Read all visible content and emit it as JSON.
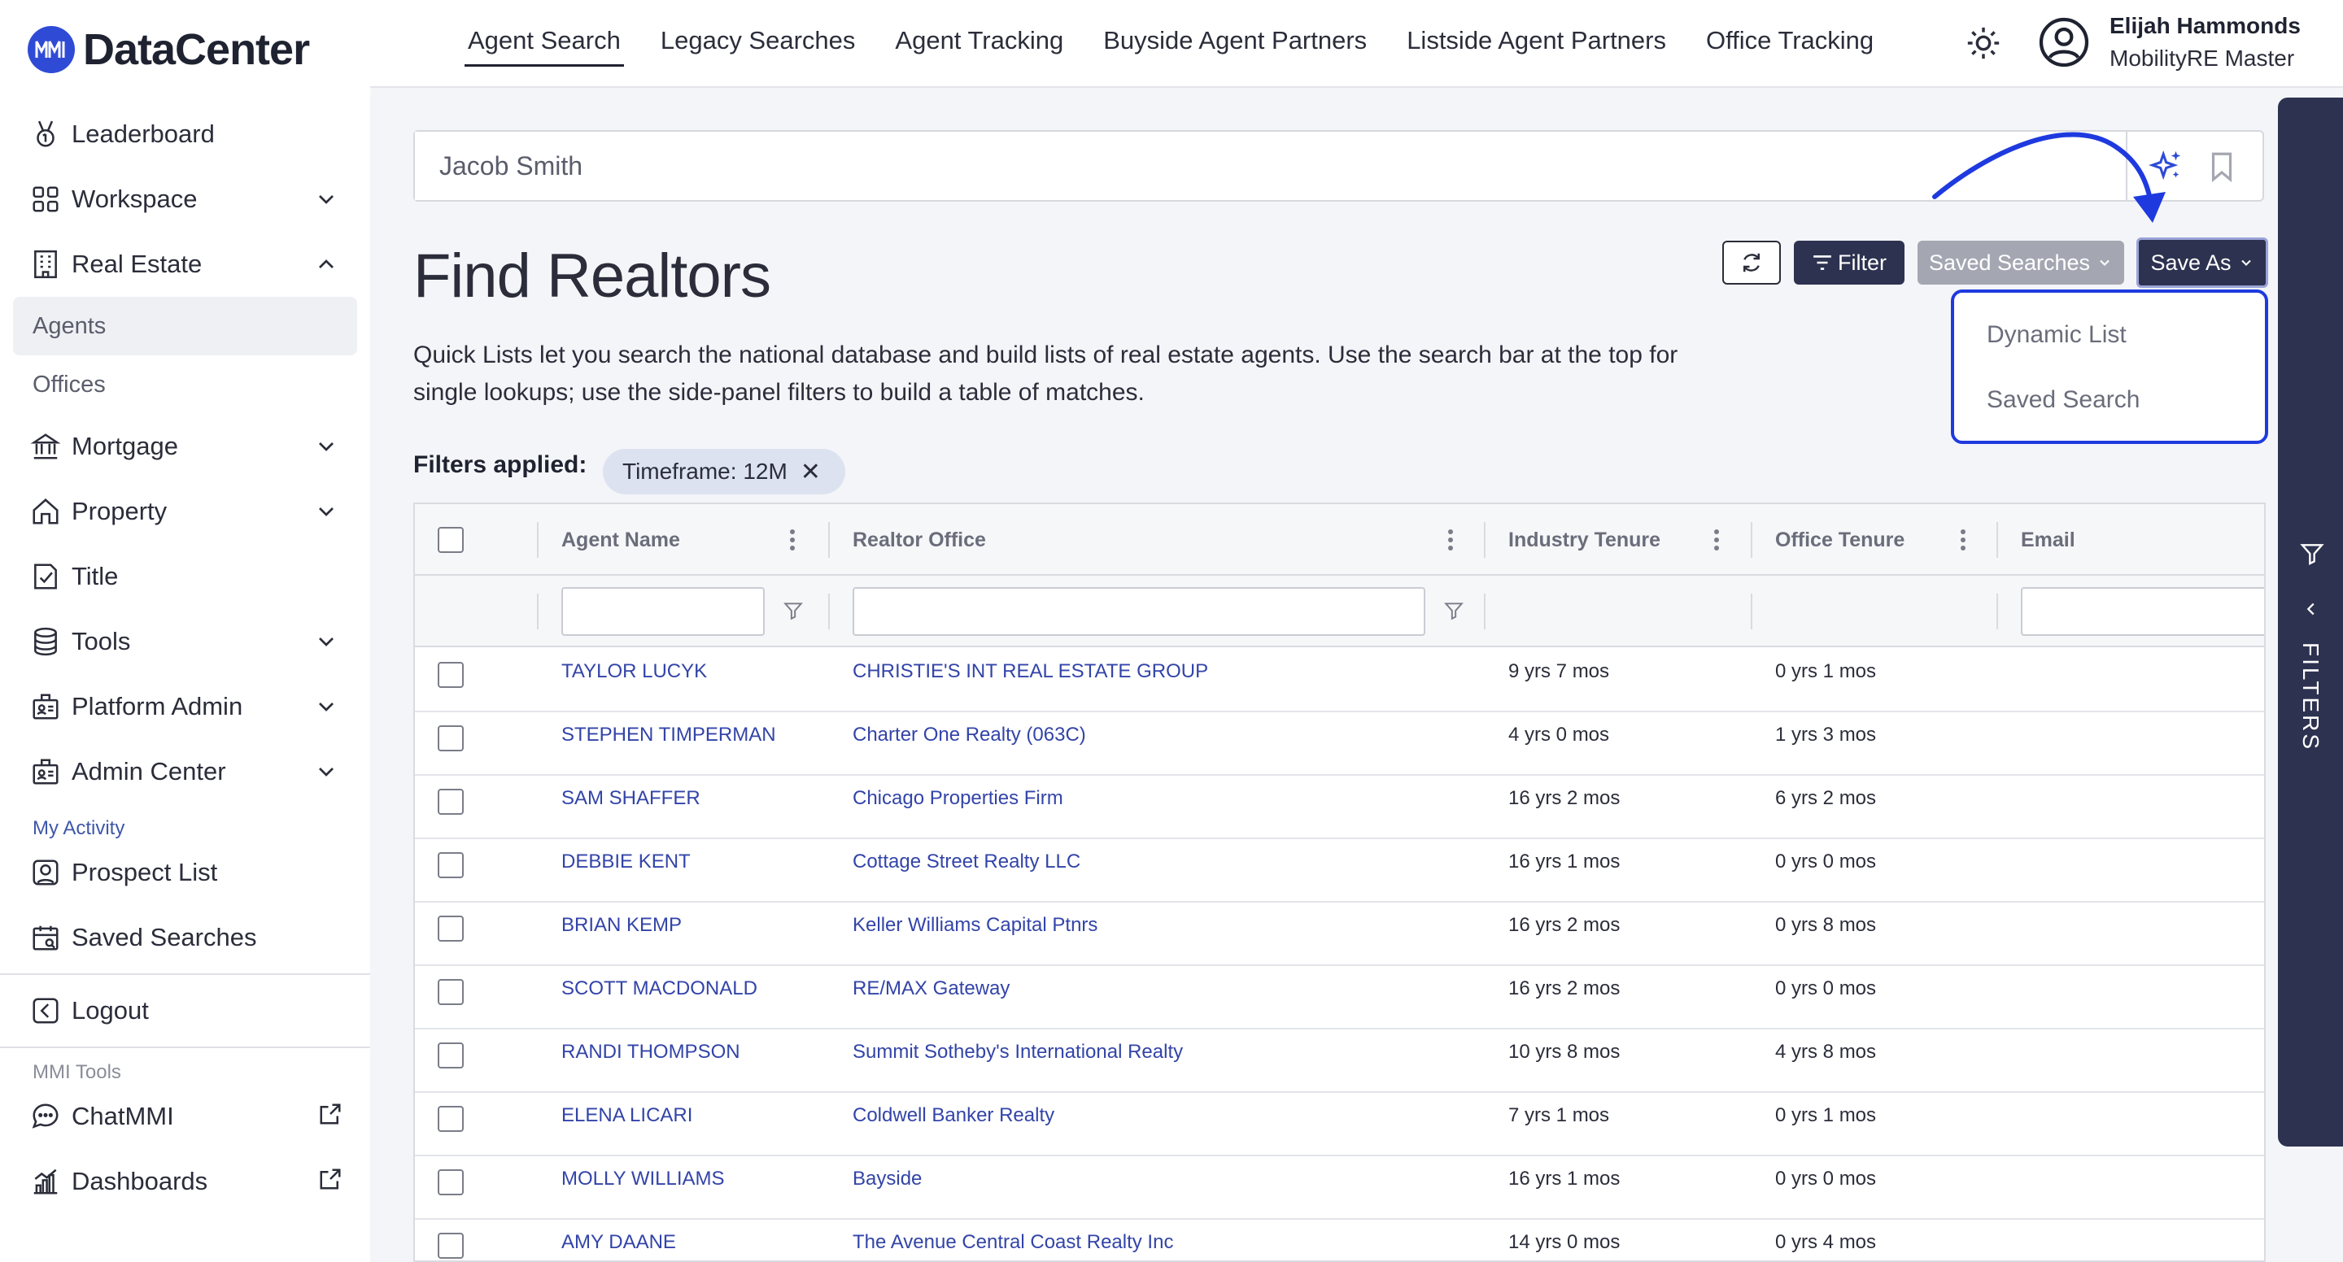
{
  "brand": {
    "logo_mark": "MMI",
    "name": "DataCenter",
    "accent": "#2f4bd6"
  },
  "sidebar": {
    "items": [
      {
        "label": "Leaderboard",
        "icon": "medal-icon"
      },
      {
        "label": "Workspace",
        "icon": "grid-icon",
        "expandable": true
      },
      {
        "label": "Real Estate",
        "icon": "building-icon",
        "expanded": true
      }
    ],
    "real_estate_sub": [
      {
        "label": "Agents",
        "active": true
      },
      {
        "label": "Offices"
      }
    ],
    "items2": [
      {
        "label": "Mortgage",
        "icon": "bank-icon"
      },
      {
        "label": "Property",
        "icon": "house-icon"
      },
      {
        "label": "Title",
        "icon": "certificate-icon"
      },
      {
        "label": "Tools",
        "icon": "database-icon"
      },
      {
        "label": "Platform Admin",
        "icon": "id-badge-icon"
      },
      {
        "label": "Admin Center",
        "icon": "id-badge-icon"
      }
    ],
    "my_activity_label": "My Activity",
    "activity": [
      {
        "label": "Prospect List"
      },
      {
        "label": "Saved Searches"
      }
    ],
    "logout": "Logout",
    "tools_label": "MMI Tools",
    "tools": [
      {
        "label": "ChatMMI"
      },
      {
        "label": "Dashboards"
      }
    ]
  },
  "topnav": {
    "tabs": [
      "Agent Search",
      "Legacy Searches",
      "Agent Tracking",
      "Buyside Agent Partners",
      "Listside Agent Partners",
      "Office Tracking"
    ],
    "active_tab": "Agent Search",
    "user": {
      "name": "Elijah Hammonds",
      "role": "MobilityRE Master"
    }
  },
  "search": {
    "value": "Jacob Smith"
  },
  "page": {
    "title": "Find Realtors",
    "description": "Quick Lists let you search the national database and build lists of real estate agents. Use the search bar at the top for single lookups; use the side-panel filters to build a table of matches."
  },
  "toolbar": {
    "filter_label": "Filter",
    "saved_searches_label": "Saved Searches",
    "save_as_label": "Save As",
    "dropdown": [
      "Dynamic List",
      "Saved Search"
    ]
  },
  "filters_applied": {
    "label": "Filters applied:",
    "chips": [
      "Timeframe: 12M"
    ]
  },
  "table": {
    "columns": [
      "Agent Name",
      "Realtor Office",
      "Industry Tenure",
      "Office Tenure",
      "Email"
    ],
    "rows": [
      {
        "name": "TAYLOR LUCYK",
        "office": "CHRISTIE'S INT REAL ESTATE GROUP",
        "industry": "9 yrs 7 mos",
        "office_tenure": "0 yrs 1 mos"
      },
      {
        "name": "STEPHEN TIMPERMAN",
        "office": "Charter One Realty (063C)",
        "industry": "4 yrs 0 mos",
        "office_tenure": "1 yrs 3 mos"
      },
      {
        "name": "SAM SHAFFER",
        "office": "Chicago Properties Firm",
        "industry": "16 yrs 2 mos",
        "office_tenure": "6 yrs 2 mos"
      },
      {
        "name": "DEBBIE KENT",
        "office": "Cottage Street Realty LLC",
        "industry": "16 yrs 1 mos",
        "office_tenure": "0 yrs 0 mos"
      },
      {
        "name": "BRIAN KEMP",
        "office": "Keller Williams Capital Ptnrs",
        "industry": "16 yrs 2 mos",
        "office_tenure": "0 yrs 8 mos"
      },
      {
        "name": "SCOTT MACDONALD",
        "office": "RE/MAX Gateway",
        "industry": "16 yrs 2 mos",
        "office_tenure": "0 yrs 0 mos"
      },
      {
        "name": "RANDI THOMPSON",
        "office": "Summit Sotheby's International Realty",
        "industry": "10 yrs 8 mos",
        "office_tenure": "4 yrs 8 mos"
      },
      {
        "name": "ELENA LICARI",
        "office": "Coldwell Banker Realty",
        "industry": "7 yrs 1 mos",
        "office_tenure": "0 yrs 1 mos"
      },
      {
        "name": "MOLLY WILLIAMS",
        "office": "Bayside",
        "industry": "16 yrs 1 mos",
        "office_tenure": "0 yrs 0 mos"
      },
      {
        "name": "AMY DAANE",
        "office": "The Avenue Central Coast Realty Inc",
        "industry": "14 yrs 0 mos",
        "office_tenure": "0 yrs 4 mos"
      }
    ]
  },
  "side_panel": {
    "label": "FILTERS"
  },
  "colors": {
    "navy": "#2d3250",
    "link": "#3344a8",
    "highlight": "#1e3adf"
  }
}
